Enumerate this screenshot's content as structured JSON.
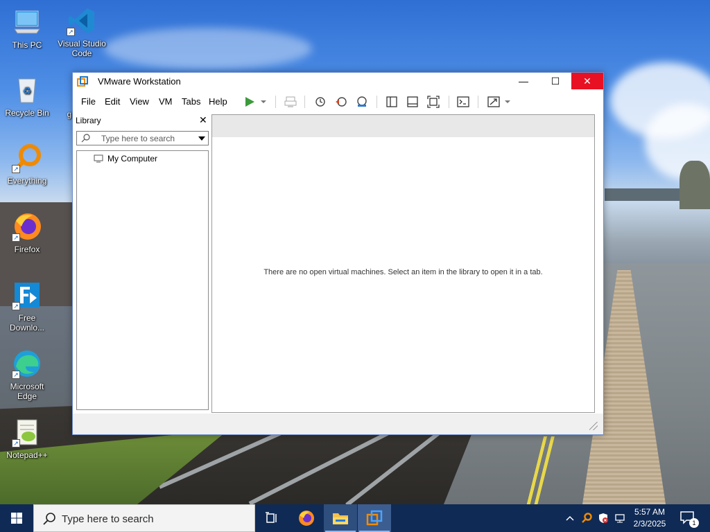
{
  "desktop": {
    "icons": [
      {
        "label": "This PC",
        "icon": "this-pc-icon"
      },
      {
        "label": "Visual Studio Code",
        "icon": "vscode-icon"
      },
      {
        "label": "Recycle Bin",
        "icon": "recycle-bin-icon"
      },
      {
        "label": "gi",
        "icon": "partial-icon"
      },
      {
        "label": "Everything",
        "icon": "everything-search-icon"
      },
      {
        "label": "Firefox",
        "icon": "firefox-icon"
      },
      {
        "label": "Free Downlo...",
        "icon": "free-download-manager-icon"
      },
      {
        "label": "Microsoft Edge",
        "icon": "edge-icon"
      },
      {
        "label": "Notepad++",
        "icon": "notepad-plus-plus-icon"
      }
    ]
  },
  "window": {
    "title": "VMware Workstation",
    "minimize": "—",
    "maximize": "☐",
    "close": "✕",
    "menu": [
      "File",
      "Edit",
      "View",
      "VM",
      "Tabs",
      "Help"
    ],
    "toolbar_icons": [
      "power-on-icon",
      "dropdown-arrow-icon",
      "send-ctrl-alt-del-icon",
      "snapshot-icon",
      "revert-snapshot-icon",
      "snapshot-manager-icon",
      "library-view-icon",
      "thumbnail-bar-icon",
      "full-screen-icon",
      "console-view-icon",
      "unity-icon",
      "stretch-dropdown-icon"
    ],
    "accent": "#3c9a3c",
    "close_color": "#e81123"
  },
  "library": {
    "title": "Library",
    "close_glyph": "✕",
    "search_placeholder": "Type here to search",
    "items": [
      {
        "label": "My Computer",
        "icon": "monitor-icon"
      }
    ]
  },
  "main": {
    "empty_message": "There are no open virtual machines. Select an item in the library to open it in a tab."
  },
  "taskbar": {
    "search_placeholder": "Type here to search",
    "apps": [
      "task-view-icon",
      "firefox-icon",
      "file-explorer-icon",
      "vmware-workstation-icon"
    ],
    "tray_icons": [
      "show-hidden-icons-icon",
      "everything-tray-icon",
      "security-shield-icon",
      "network-icon",
      "volume-icon"
    ],
    "clock_time": "5:57 AM",
    "clock_date": "2/3/2025",
    "notification_count": "1"
  }
}
